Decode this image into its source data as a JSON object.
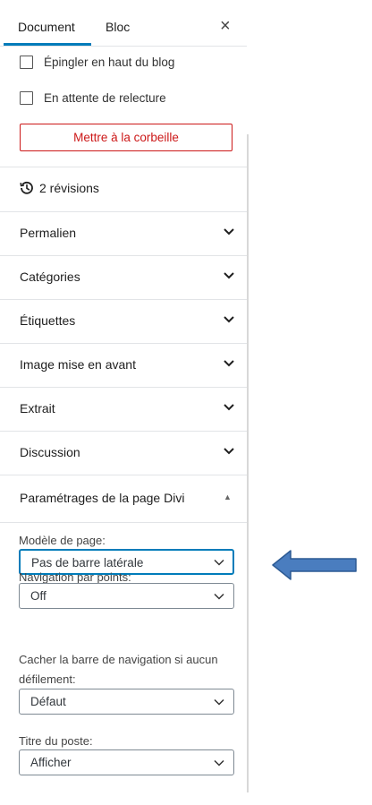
{
  "tabs": {
    "document": "Document",
    "bloc": "Bloc",
    "close": "×"
  },
  "checkboxes": [
    {
      "label": "Épingler en haut du blog",
      "checked": false
    },
    {
      "label": "En attente de relecture",
      "checked": false
    }
  ],
  "trash_button": "Mettre à la corbeille",
  "revisions": "2 révisions",
  "sections": [
    {
      "title": "Permalien"
    },
    {
      "title": "Catégories"
    },
    {
      "title": "Étiquettes"
    },
    {
      "title": "Image mise en avant"
    },
    {
      "title": "Extrait"
    },
    {
      "title": "Discussion"
    },
    {
      "title": "Paramétrages de la page Divi"
    }
  ],
  "divi": {
    "page_template_label": "Modèle de page:",
    "page_template_value": "Pas de barre latérale",
    "dot_nav_label": "Navigation par points:",
    "dot_nav_value": "Off",
    "hide_nav_label_1": "Cacher la barre de navigation si aucun",
    "hide_nav_label_2": "défilement:",
    "hide_nav_value": "Défaut",
    "post_title_label": "Titre du poste:",
    "post_title_value": "Afficher"
  },
  "colors": {
    "accent": "#007cba",
    "danger": "#cc1818",
    "arrow": "#3f6fb0"
  }
}
